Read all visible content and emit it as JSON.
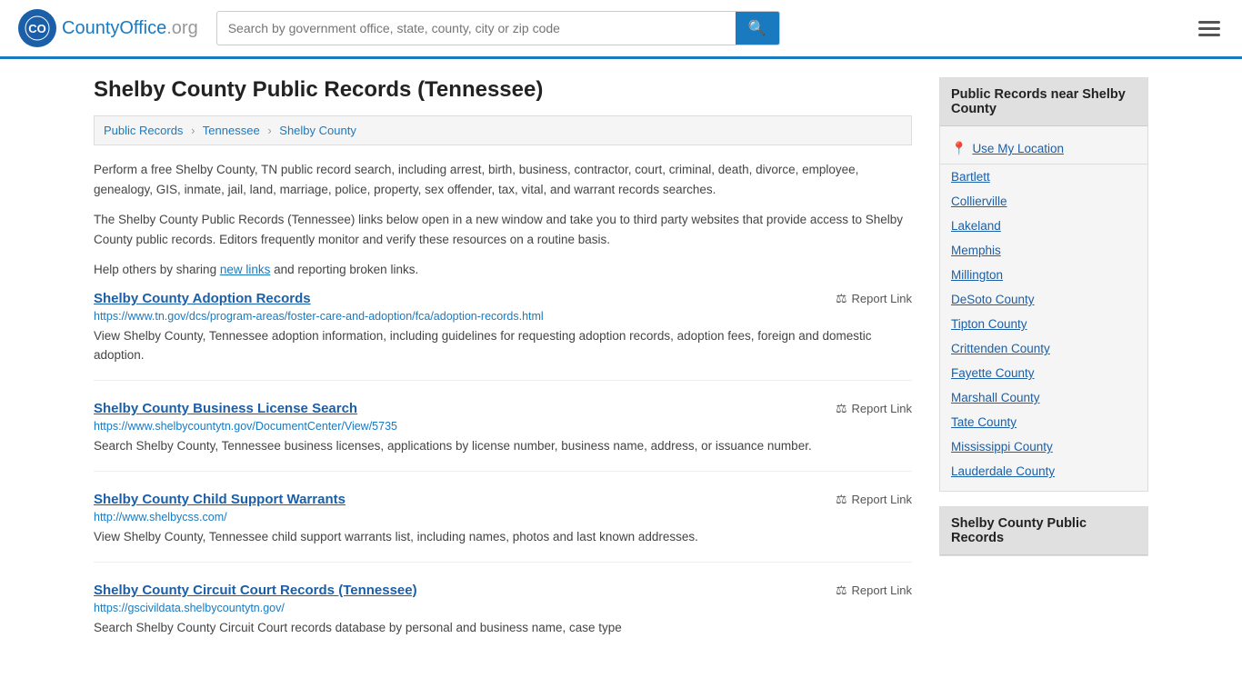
{
  "header": {
    "logo_text": "CountyOffice",
    "logo_ext": ".org",
    "search_placeholder": "Search by government office, state, county, city or zip code",
    "search_value": ""
  },
  "page": {
    "title": "Shelby County Public Records (Tennessee)",
    "breadcrumb": [
      {
        "label": "Public Records",
        "href": "#"
      },
      {
        "label": "Tennessee",
        "href": "#"
      },
      {
        "label": "Shelby County",
        "href": "#"
      }
    ],
    "description1": "Perform a free Shelby County, TN public record search, including arrest, birth, business, contractor, court, criminal, death, divorce, employee, genealogy, GIS, inmate, jail, land, marriage, police, property, sex offender, tax, vital, and warrant records searches.",
    "description2": "The Shelby County Public Records (Tennessee) links below open in a new window and take you to third party websites that provide access to Shelby County public records. Editors frequently monitor and verify these resources on a routine basis.",
    "description3_prefix": "Help others by sharing ",
    "description3_link": "new links",
    "description3_suffix": " and reporting broken links."
  },
  "records": [
    {
      "title": "Shelby County Adoption Records",
      "url": "https://www.tn.gov/dcs/program-areas/foster-care-and-adoption/fca/adoption-records.html",
      "description": "View Shelby County, Tennessee adoption information, including guidelines for requesting adoption records, adoption fees, foreign and domestic adoption.",
      "report_label": "Report Link"
    },
    {
      "title": "Shelby County Business License Search",
      "url": "https://www.shelbycountytn.gov/DocumentCenter/View/5735",
      "description": "Search Shelby County, Tennessee business licenses, applications by license number, business name, address, or issuance number.",
      "report_label": "Report Link"
    },
    {
      "title": "Shelby County Child Support Warrants",
      "url": "http://www.shelbycss.com/",
      "description": "View Shelby County, Tennessee child support warrants list, including names, photos and last known addresses.",
      "report_label": "Report Link"
    },
    {
      "title": "Shelby County Circuit Court Records (Tennessee)",
      "url": "https://gscivildata.shelbycountytn.gov/",
      "description": "Search Shelby County Circuit Court records database by personal and business name, case type",
      "report_label": "Report Link"
    }
  ],
  "sidebar": {
    "nearby_header": "Public Records near Shelby County",
    "use_location_label": "Use My Location",
    "nearby_links": [
      "Bartlett",
      "Collierville",
      "Lakeland",
      "Memphis",
      "Millington",
      "DeSoto County",
      "Tipton County",
      "Crittenden County",
      "Fayette County",
      "Marshall County",
      "Tate County",
      "Mississippi County",
      "Lauderdale County"
    ],
    "records_header": "Shelby County Public Records"
  }
}
